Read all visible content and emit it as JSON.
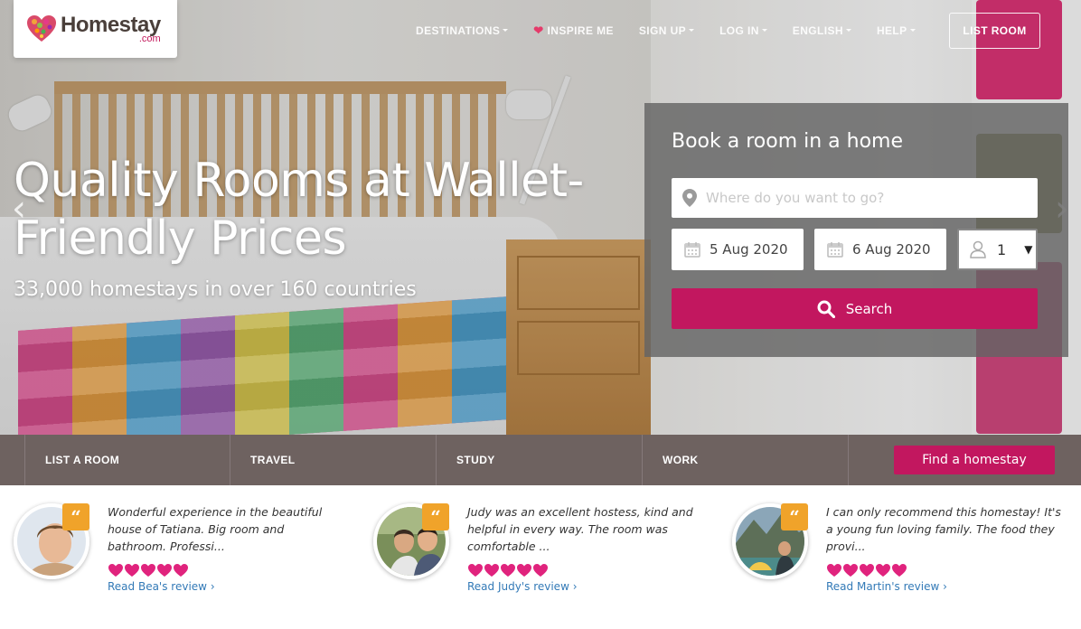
{
  "brand": {
    "name": "Homestay",
    "tld": ".com"
  },
  "nav": {
    "items": [
      {
        "label": "DESTINATIONS",
        "dropdown": true,
        "icon": null
      },
      {
        "label": "INSPIRE ME",
        "dropdown": false,
        "icon": "heart-icon"
      },
      {
        "label": "SIGN UP",
        "dropdown": true,
        "icon": null
      },
      {
        "label": "LOG IN",
        "dropdown": true,
        "icon": null
      },
      {
        "label": "ENGLISH",
        "dropdown": true,
        "icon": null
      },
      {
        "label": "HELP",
        "dropdown": true,
        "icon": null
      }
    ],
    "list_room_label": "LIST ROOM"
  },
  "hero": {
    "title": "Quality Rooms at Wallet-Friendly Prices",
    "subtitle": "33,000 homestays in over 160 countries"
  },
  "booking": {
    "title": "Book a room in a home",
    "where_placeholder": "Where do you want to go?",
    "check_in": "5 Aug 2020",
    "check_out": "6 Aug 2020",
    "guests": "1",
    "search_label": "Search"
  },
  "tabs": {
    "items": [
      "LIST A ROOM",
      "TRAVEL",
      "STUDY",
      "WORK"
    ],
    "find_label": "Find a homestay"
  },
  "reviews": [
    {
      "text": "Wonderful experience in the beautiful house of Tatiana. Big room and bathroom. Professi...",
      "rating": 5,
      "link": "Read Bea's review",
      "quote_glyph": "“"
    },
    {
      "text": "Judy was an excellent hostess, kind and helpful in every way. The room was comfortable ...",
      "rating": 5,
      "link": "Read Judy's review",
      "quote_glyph": "“"
    },
    {
      "text": "I can only recommend this homestay! It's a young fun loving family. The food they provi...",
      "rating": 5,
      "link": "Read Martin's review",
      "quote_glyph": "“"
    }
  ],
  "link_chevron": "›",
  "colors": {
    "accent": "#c2175f",
    "tabs_bg": "#6e6260",
    "quote": "#f0a32a",
    "link": "#337ab7"
  }
}
